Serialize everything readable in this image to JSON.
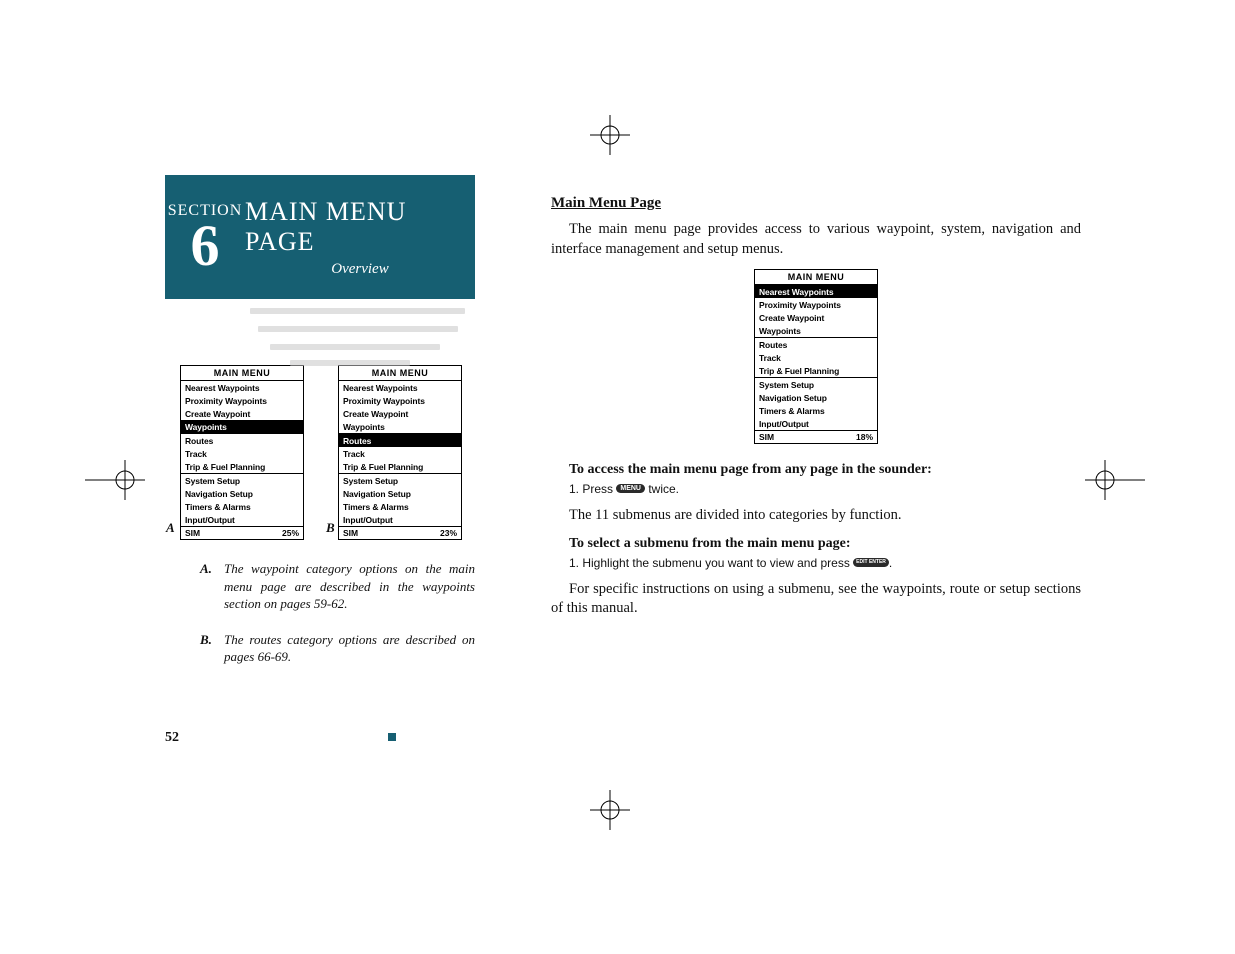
{
  "section": {
    "label": "SECTION",
    "number": "6",
    "title": "MAIN MENU PAGE",
    "subtitle": "Overview"
  },
  "menu": {
    "header": "MAIN MENU",
    "g1": [
      "Nearest Waypoints",
      "Proximity Waypoints",
      "Create Waypoint",
      "Waypoints"
    ],
    "g2": [
      "Routes",
      "Track",
      "Trip & Fuel Planning"
    ],
    "g3": [
      "System Setup",
      "Navigation Setup",
      "Timers & Alarms",
      "Input/Output"
    ],
    "status_label": "SIM"
  },
  "screens": {
    "a_highlight_index": 3,
    "a_status": "25%",
    "b_highlight_index": 0,
    "b_status": "23%",
    "c_highlight_index": 0,
    "c_status": "18%",
    "label_a": "A",
    "label_b": "B"
  },
  "captions": {
    "a_letter": "A.",
    "a_text": "The waypoint category options on the main menu page are described in the waypoints section on pages 59-62.",
    "b_letter": "B.",
    "b_text": "The routes category options are described on pages 66-69."
  },
  "body": {
    "heading": "Main Menu Page",
    "p1": "The main menu page provides access to various waypoint, system, navigation and interface management and setup menus.",
    "line1": "To access the main menu page from any page in the sounder:",
    "step1_pre": "1. Press ",
    "step1_btn": "MENU",
    "step1_post": " twice.",
    "p2": "The 11 submenus are divided into categories by function.",
    "line2": "To select a submenu from the main menu page:",
    "step2_pre": "1. Highlight the submenu you want to view and press ",
    "step2_btn": "EDIT\nENTER",
    "step2_post": ".",
    "p3": "For specific instructions on using a submenu, see the waypoints, route or setup sections of this manual."
  },
  "page_number": "52"
}
